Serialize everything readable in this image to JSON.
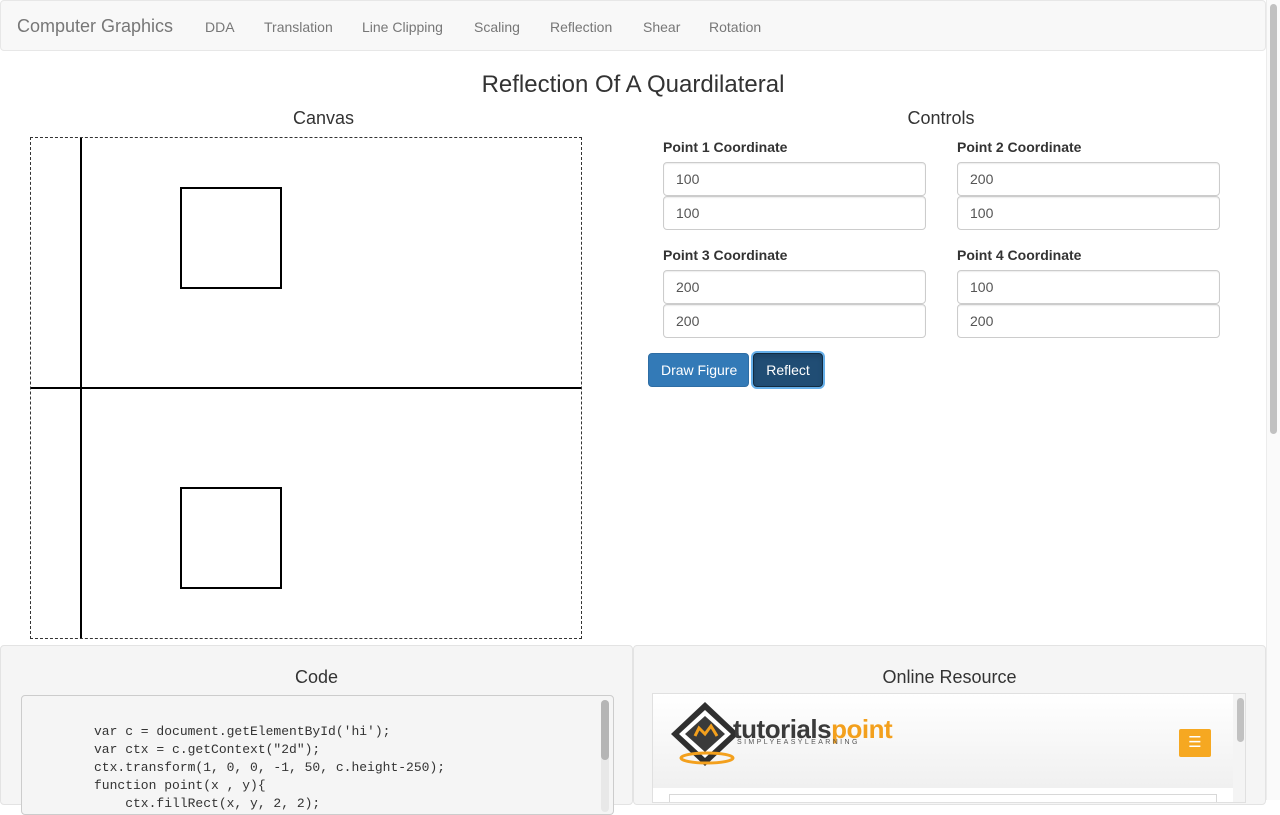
{
  "nav": {
    "brand": "Computer Graphics",
    "links": [
      "DDA",
      "Translation",
      "Line Clipping",
      "Scaling",
      "Reflection",
      "Shear",
      "Rotation"
    ]
  },
  "page": {
    "title": "Reflection Of A Quardilateral",
    "canvas_heading": "Canvas",
    "controls_heading": "Controls"
  },
  "controls": {
    "point1": {
      "label": "Point 1 Coordinate",
      "x": "100",
      "y": "100"
    },
    "point2": {
      "label": "Point 2 Coordinate",
      "x": "200",
      "y": "100"
    },
    "point3": {
      "label": "Point 3 Coordinate",
      "x": "200",
      "y": "200"
    },
    "point4": {
      "label": "Point 4 Coordinate",
      "x": "100",
      "y": "200"
    },
    "draw_button": "Draw Figure",
    "reflect_button": "Reflect"
  },
  "code_panel": {
    "title": "Code",
    "lines": [
      "var c = document.getElementById('hi');",
      "var ctx = c.getContext(\"2d\");",
      "ctx.transform(1, 0, 0, -1, 50, c.height-250);",
      "function point(x , y){",
      "    ctx.fillRect(x, y, 2, 2);"
    ]
  },
  "resource_panel": {
    "title": "Online Resource",
    "logo_main": "tutorials",
    "logo_accent": "point",
    "tagline": "SIMPLYEASYLEARNING",
    "menu_icon": "hamburger-menu-icon"
  },
  "colors": {
    "primary_button": "#337ab7",
    "active_button": "#204d74",
    "brand_orange": "#f6a821"
  }
}
